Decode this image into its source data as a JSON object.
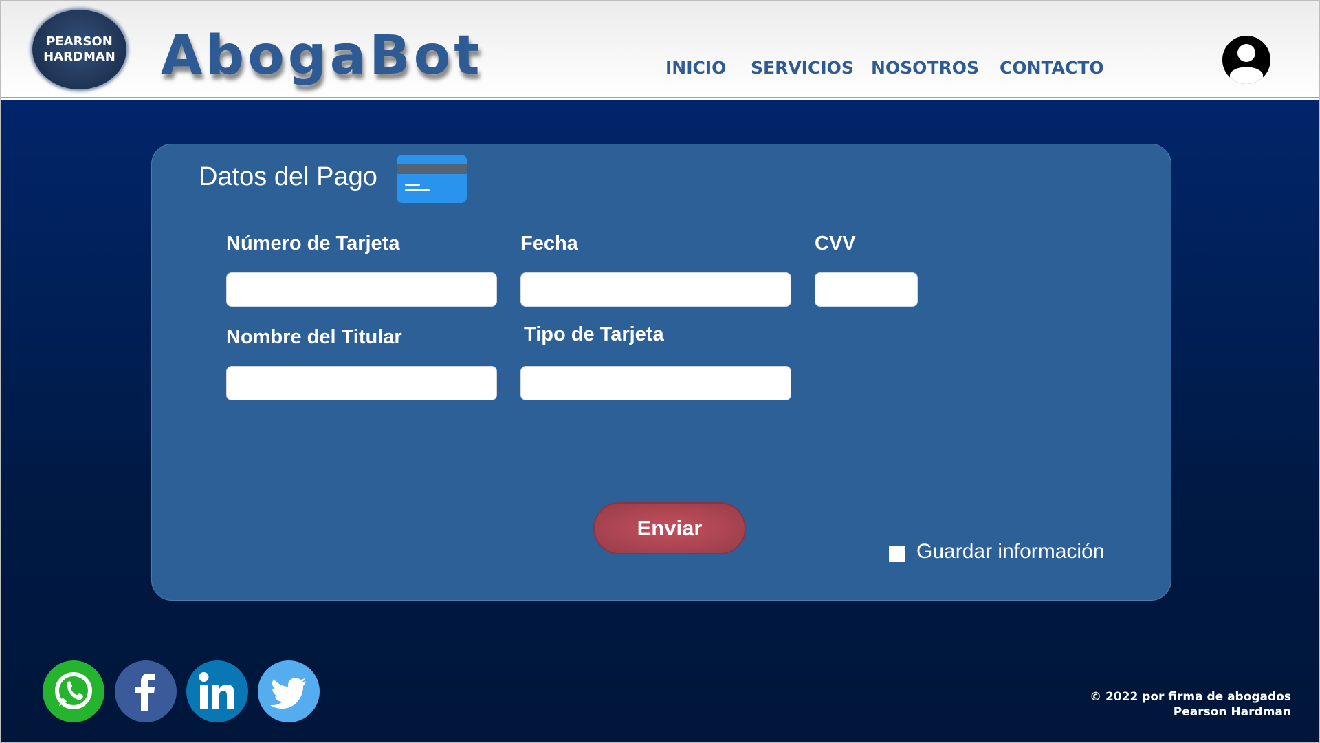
{
  "header": {
    "logo_line1": "PEARSON",
    "logo_line2": "HARDMAN",
    "brand": "AbogaBot",
    "nav": [
      "INICIO",
      "SERVICIOS",
      "NOSOTROS",
      "CONTACTO"
    ],
    "user_icon": "user-circle-icon"
  },
  "form": {
    "title": "Datos del Pago",
    "title_icon": "credit-card-icon",
    "fields": {
      "card_number": {
        "label": "Número de Tarjeta",
        "value": ""
      },
      "date": {
        "label": "Fecha",
        "value": ""
      },
      "cvv": {
        "label": "CVV",
        "value": ""
      },
      "holder": {
        "label": "Nombre del Titular",
        "value": ""
      },
      "card_type": {
        "label": "Tipo de Tarjeta",
        "value": ""
      }
    },
    "submit_label": "Enviar",
    "save_label": "Guardar información",
    "save_checked": false
  },
  "footer": {
    "social": [
      "whatsapp-icon",
      "facebook-icon",
      "linkedin-icon",
      "twitter-icon"
    ],
    "copyright_line1": "© 2022 por firma de abogados",
    "copyright_line2": "Pearson Hardman"
  },
  "colors": {
    "brand": "#2e5b94",
    "card": "#2c6096",
    "background": "#01256a",
    "submit": "#b04a56",
    "whatsapp": "#25b42e",
    "facebook": "#3b5a9a",
    "linkedin": "#0a77b5",
    "twitter": "#55acee"
  }
}
